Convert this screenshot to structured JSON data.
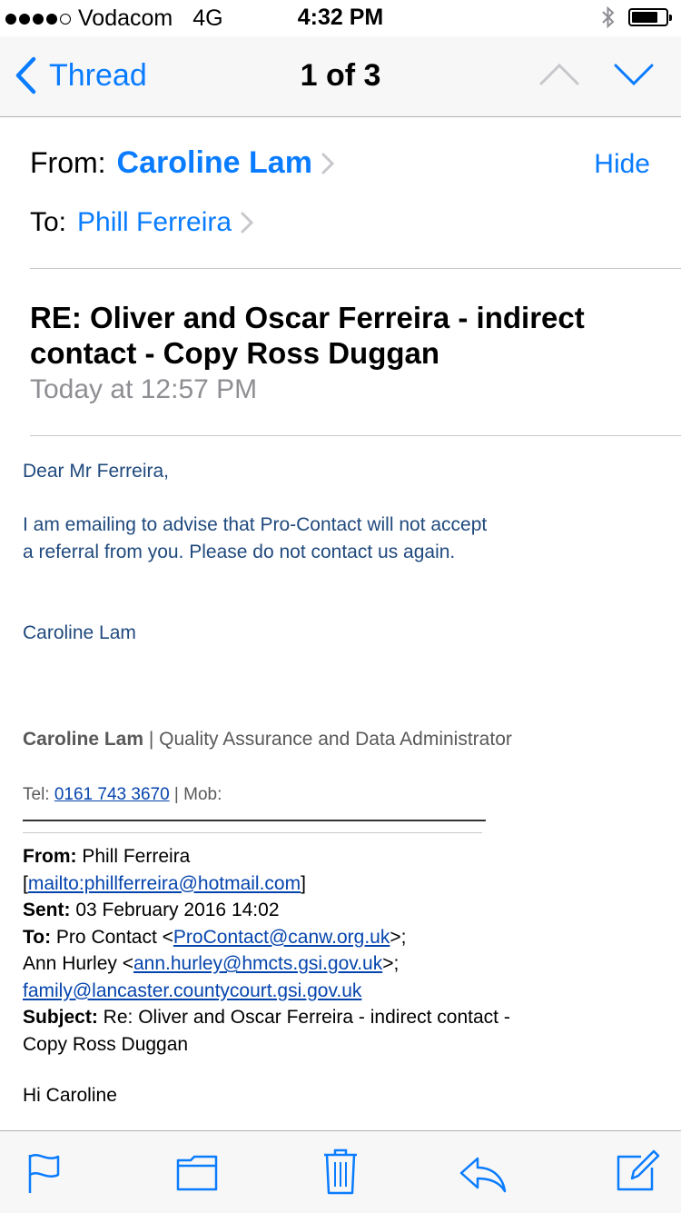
{
  "status_bar": {
    "carrier": "Vodacom",
    "network": "4G",
    "time": "4:32 PM",
    "signal_bars": 4,
    "battery_level": 0.65,
    "icons": [
      "bluetooth-icon",
      "battery-icon"
    ]
  },
  "nav": {
    "back_label": "Thread",
    "title": "1 of 3",
    "icons": [
      "chevron-left-icon",
      "chevron-up-icon",
      "chevron-down-icon"
    ],
    "accent": "#0a7cff"
  },
  "header": {
    "from_label": "From:",
    "from_name": "Caroline Lam",
    "hide_label": "Hide",
    "to_label": "To:",
    "to_name": "Phill Ferreira",
    "subject": "RE: Oliver and Oscar Ferreira - indirect contact - Copy Ross Duggan",
    "date": "Today at 12:57 PM"
  },
  "body": {
    "greeting": "Dear Mr Ferreira,",
    "paragraph": "I am emailing to advise that Pro-Contact will not accept a referral from you.  Please do not contact us again.",
    "signoff": "Caroline Lam",
    "signature_name": "Caroline Lam",
    "signature_title": " | Quality Assurance and Data Administrator",
    "tel_label": "Tel: ",
    "tel_number": "0161 743 3670",
    "mob_label": " | Mob:"
  },
  "quoted": {
    "from_label": "From:",
    "from_value": " Phill Ferreira",
    "from_bracket_open": "[",
    "from_mailto": "mailto:phillferreira@hotmail.com",
    "from_bracket_close": "]",
    "sent_label": "Sent:",
    "sent_value": " 03 February 2016 14:02",
    "to_label": "To:",
    "to_value_1": " Pro Contact <",
    "to_email_1": "ProContact@canw.org.uk",
    "to_value_2": ">;",
    "to_value_3": "Ann Hurley <",
    "to_email_2": "ann.hurley@hmcts.gsi.gov.uk",
    "to_value_4": ">;",
    "to_email_3": "family@lancaster.countycourt.gsi.gov.uk",
    "subject_label": "Subject:",
    "subject_value": " Re: Oliver and Oscar Ferreira - indirect contact - Copy Ross Duggan",
    "greeting": "Hi  Caroline"
  },
  "toolbar": {
    "icons": [
      "flag-icon",
      "folder-icon",
      "trash-icon",
      "reply-icon",
      "compose-icon"
    ]
  },
  "colors": {
    "link": "#0a7cff",
    "body_text": "#1f497d",
    "signature_grey": "#595959",
    "muted": "#8e8e93"
  }
}
